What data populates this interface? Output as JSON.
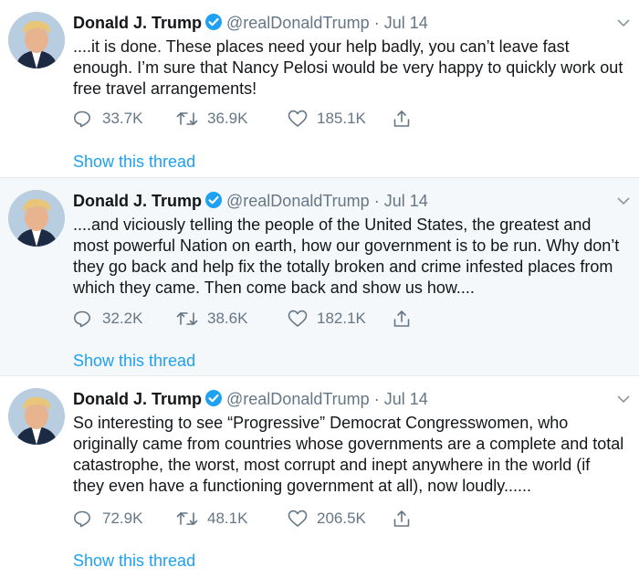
{
  "author": {
    "name": "Donald J. Trump",
    "handle": "@realDonaldTrump",
    "separator": "·"
  },
  "tweets": [
    {
      "date": "Jul 14",
      "lines": [
        "....it is done. These places need your help badly, you can’t leave fast",
        "enough. I’m sure that Nancy Pelosi would be very happy to quickly work out",
        "free travel arrangements!"
      ],
      "replies": "33.7K",
      "retweets": "36.9K",
      "likes": "185.1K",
      "show_thread": "Show this thread"
    },
    {
      "date": "Jul 14",
      "lines": [
        "....and viciously telling the people of the United States, the greatest and",
        "most powerful Nation on earth, how our government is to be run. Why don’t",
        "they go back and help fix the totally broken and crime infested places from",
        "which they came. Then come back and show us how...."
      ],
      "replies": "32.2K",
      "retweets": "38.6K",
      "likes": "182.1K",
      "show_thread": "Show this thread"
    },
    {
      "date": "Jul 14",
      "lines": [
        "So interesting to see “Progressive” Democrat Congresswomen, who",
        "originally came from countries whose governments are a complete and total",
        "catastrophe, the worst, most corrupt and inept anywhere in the world (if",
        "they even have a functioning government at all), now loudly......"
      ],
      "replies": "72.9K",
      "retweets": "48.1K",
      "likes": "206.5K",
      "show_thread": "Show this thread"
    }
  ],
  "icons": {
    "verified": "verified-badge-icon",
    "caret": "chevron-down-icon",
    "reply": "reply-icon",
    "retweet": "retweet-icon",
    "like": "heart-icon",
    "share": "share-icon"
  },
  "colors": {
    "link": "#1da1f2",
    "secondary": "#657786",
    "shaded_bg": "#f5f8fa",
    "divider": "#e6ecf0"
  }
}
